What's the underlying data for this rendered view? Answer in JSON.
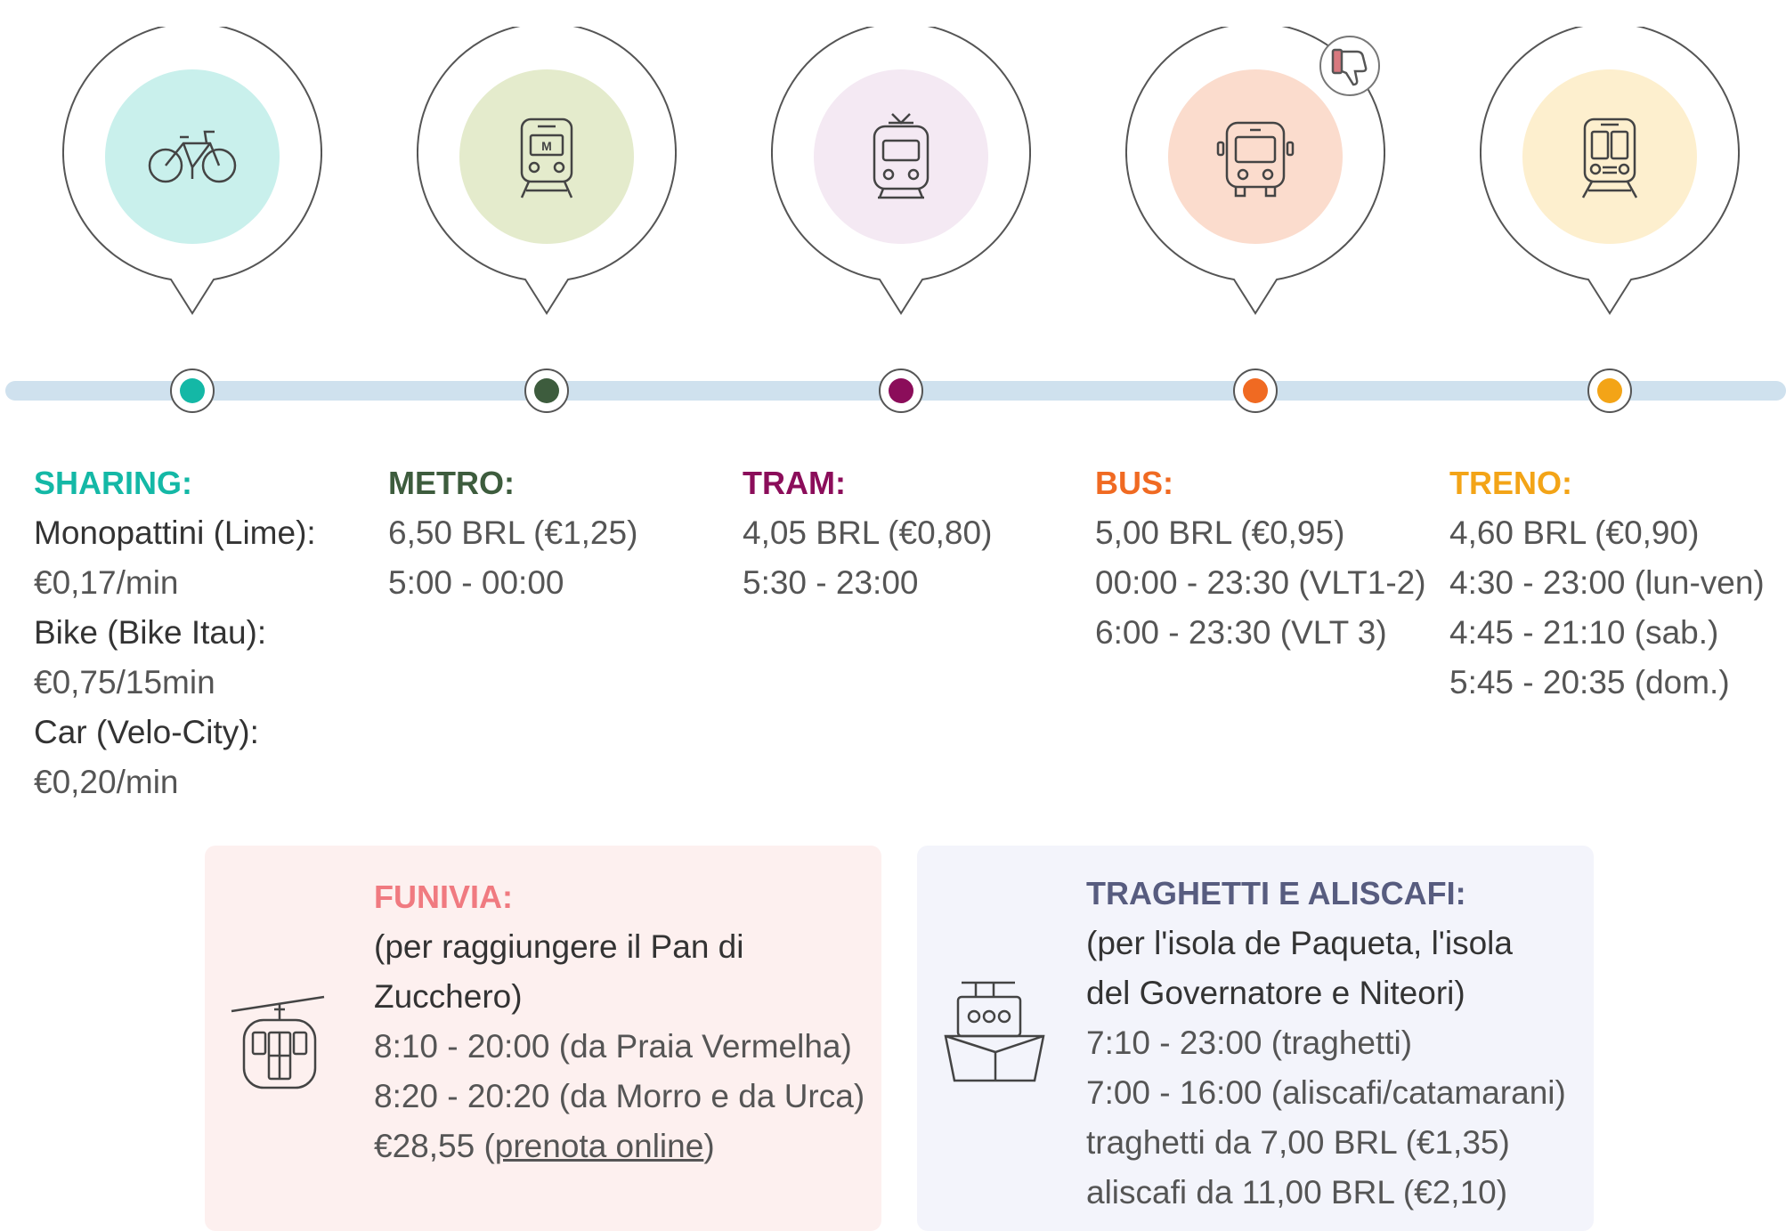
{
  "colors": {
    "sharing": "#14b8a6",
    "metro": "#3d5c3d",
    "tram": "#8b0d5a",
    "bus": "#f06a22",
    "treno": "#f3a417",
    "funivia": "#f07a80",
    "traghetti": "#575c7f",
    "track": "#cfe1ee"
  },
  "bubbles": [
    {
      "icon": "bicycle-icon",
      "bg": "#c9f0ec"
    },
    {
      "icon": "metro-train-icon",
      "bg": "#e4ebcc",
      "badge": "M"
    },
    {
      "icon": "tram-icon",
      "bg": "#f4e9f3"
    },
    {
      "icon": "bus-icon",
      "bg": "#fbdccd",
      "extra": "thumbs-down-icon"
    },
    {
      "icon": "train-icon",
      "bg": "#fdefce"
    }
  ],
  "columns": {
    "sharing": {
      "title": "SHARING:",
      "lines": [
        {
          "label": "Monopattini (Lime):",
          "value": "€0,17/min"
        },
        {
          "label": "Bike (Bike Itau):",
          "value": "€0,75/15min"
        },
        {
          "label": "Car (Velo-City):",
          "value": "€0,20/min"
        }
      ]
    },
    "metro": {
      "title": "METRO:",
      "lines": [
        "6,50 BRL (€1,25)",
        "5:00 - 00:00"
      ]
    },
    "tram": {
      "title": "TRAM:",
      "lines": [
        "4,05 BRL (€0,80)",
        "5:30 - 23:00"
      ]
    },
    "bus": {
      "title": "BUS:",
      "lines": [
        "5,00 BRL (€0,95)",
        "00:00 - 23:30 (VLT1-2)",
        "6:00 - 23:30 (VLT 3)"
      ]
    },
    "treno": {
      "title": "TRENO:",
      "lines": [
        "4,60 BRL (€0,90)",
        "4:30 - 23:00 (lun-ven)",
        "4:45 - 21:10 (sab.)",
        "5:45 - 20:35 (dom.)"
      ]
    }
  },
  "funivia": {
    "icon": "cable-car-icon",
    "title": "FUNIVIA:",
    "subtitle_1": "(per raggiungere il Pan di",
    "subtitle_2": "Zucchero)",
    "lines": [
      "8:10 - 20:00 (da Praia Vermelha)",
      "8:20 - 20:20 (da Morro e da Urca)"
    ],
    "price": "€28,55 (",
    "link": "prenota online",
    "price_end": ")",
    "bg": "#fdf0ef"
  },
  "traghetti": {
    "icon": "ferry-icon",
    "title": "TRAGHETTI E ALISCAFI:",
    "subtitle_1": "(per l'isola de Paqueta, l'isola",
    "subtitle_2": "del Governatore e Niteori)",
    "lines": [
      "7:10 - 23:00 (traghetti)",
      "7:00 - 16:00 (aliscafi/catamarani)",
      "traghetti da 7,00 BRL (€1,35)",
      "aliscafi da 11,00 BRL (€2,10)"
    ],
    "bg": "#f3f4fb"
  }
}
